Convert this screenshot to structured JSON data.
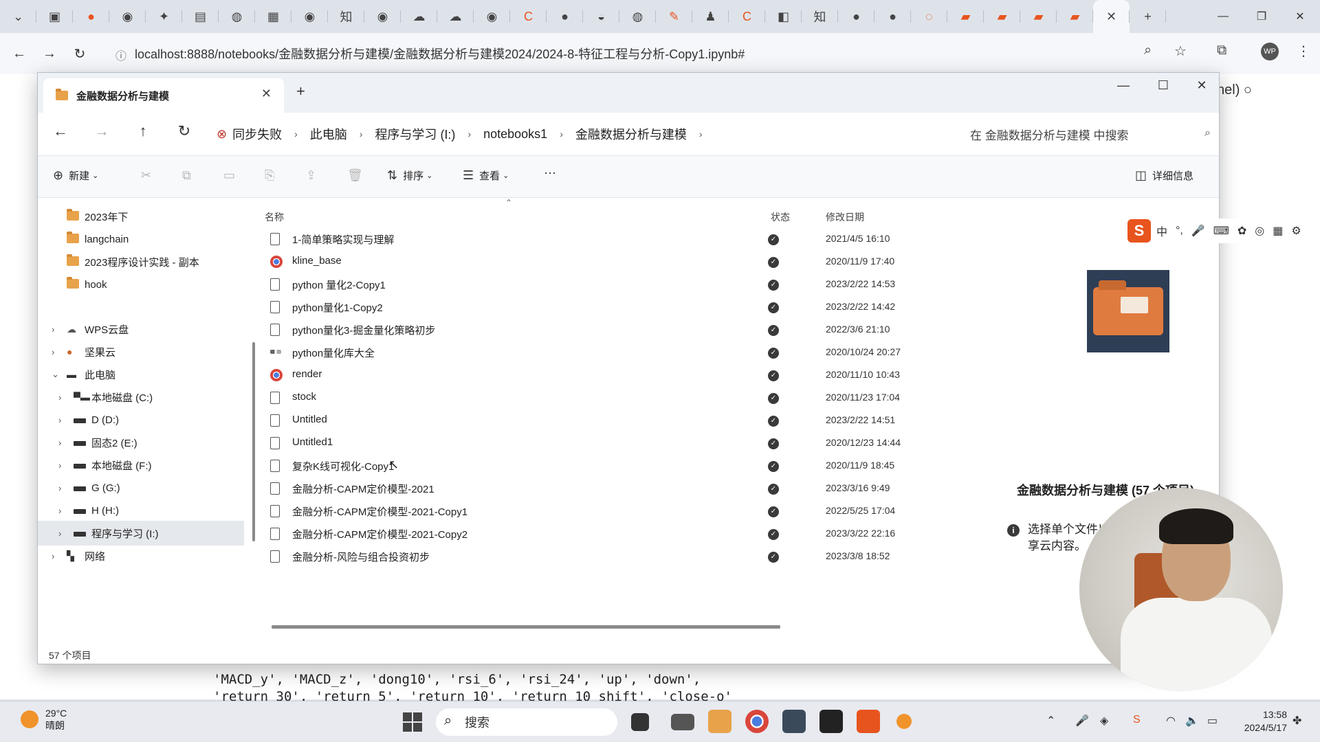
{
  "browser": {
    "url": "localhost:8888/notebooks/金融数据分析与建模/金融数据分析与建模2024/2024-8-特征工程与分析-Copy1.ipynb#",
    "profile_badge": "WP"
  },
  "jupyter": {
    "kernel_text": "nel)",
    "code_lines": [
      "'MACD_y', 'MACD_z', 'dong10', 'rsi_6', 'rsi_24', 'up', 'down',",
      "'return_30', 'return_5', 'return_10', 'return_10_shift', 'close-o'"
    ]
  },
  "explorer": {
    "tab_title": "金融数据分析与建模",
    "breadcrumb": {
      "sync_status": "同步失败",
      "items": [
        "此电脑",
        "程序与学习 (I:)",
        "notebooks1",
        "金融数据分析与建模"
      ]
    },
    "search_placeholder": "在 金融数据分析与建模 中搜索",
    "toolbar": {
      "new_label": "新建",
      "sort_label": "排序",
      "view_label": "查看",
      "more_label": "···",
      "details_label": "详细信息"
    },
    "nav_items": [
      {
        "label": "2023年下",
        "type": "folder"
      },
      {
        "label": "langchain",
        "type": "folder"
      },
      {
        "label": "2023程序设计实践 - 副本",
        "type": "folder"
      },
      {
        "label": "hook",
        "type": "folder"
      },
      {
        "label": "WPS云盘",
        "type": "cloud"
      },
      {
        "label": "坚果云",
        "type": "cloud"
      },
      {
        "label": "此电脑",
        "type": "pc"
      },
      {
        "label": "本地磁盘 (C:)",
        "type": "drive"
      },
      {
        "label": "D (D:)",
        "type": "drive"
      },
      {
        "label": "固态2 (E:)",
        "type": "drive"
      },
      {
        "label": "本地磁盘 (F:)",
        "type": "drive"
      },
      {
        "label": "G (G:)",
        "type": "drive"
      },
      {
        "label": "H (H:)",
        "type": "drive"
      },
      {
        "label": "程序与学习 (I:)",
        "type": "drive"
      },
      {
        "label": "网络",
        "type": "network"
      }
    ],
    "columns": {
      "name": "名称",
      "status": "状态",
      "modified": "修改日期"
    },
    "files": [
      {
        "name": "1-简单策略实现与理解",
        "date": "2021/4/5 16:10",
        "icon": "file-icon"
      },
      {
        "name": "kline_base",
        "date": "2020/11/9 17:40",
        "icon": "chrome-file-icon"
      },
      {
        "name": "python 量化2-Copy1",
        "date": "2023/2/22 14:53",
        "icon": "file-icon"
      },
      {
        "name": "python量化1-Copy2",
        "date": "2023/2/22 14:42",
        "icon": "file-icon"
      },
      {
        "name": "python量化3-掘金量化策略初步",
        "date": "2022/3/6 21:10",
        "icon": "file-icon"
      },
      {
        "name": "python量化库大全",
        "date": "2020/10/24 20:27",
        "icon": "py-file-icon"
      },
      {
        "name": "render",
        "date": "2020/11/10 10:43",
        "icon": "chrome-file-icon"
      },
      {
        "name": "stock",
        "date": "2020/11/23 17:04",
        "icon": "file-icon"
      },
      {
        "name": "Untitled",
        "date": "2023/2/22 14:51",
        "icon": "file-icon"
      },
      {
        "name": "Untitled1",
        "date": "2020/12/23 14:44",
        "icon": "file-icon"
      },
      {
        "name": "复杂K线可视化-Copy1",
        "date": "2020/11/9 18:45",
        "icon": "file-icon"
      },
      {
        "name": "金融分析-CAPM定价模型-2021",
        "date": "2023/3/16 9:49",
        "icon": "file-icon"
      },
      {
        "name": "金融分析-CAPM定价模型-2021-Copy1",
        "date": "2022/5/25 17:04",
        "icon": "file-icon"
      },
      {
        "name": "金融分析-CAPM定价模型-2021-Copy2",
        "date": "2023/3/22 22:16",
        "icon": "file-icon"
      },
      {
        "name": "金融分析-风险与组合投资初步",
        "date": "2023/3/8 18:52",
        "icon": "file-icon"
      }
    ],
    "details": {
      "title": "金融数据分析与建模 (57 个项目)",
      "info": "选择单个文件以获取详细信息并共享云内容。"
    },
    "status_count": "57 个项目"
  },
  "ime": {
    "mode": "中",
    "punct": "°,"
  },
  "taskbar": {
    "temperature": "29°C",
    "weather": "晴朗",
    "search_placeholder": "搜索",
    "time": "13:58",
    "date": "2024/5/17"
  }
}
